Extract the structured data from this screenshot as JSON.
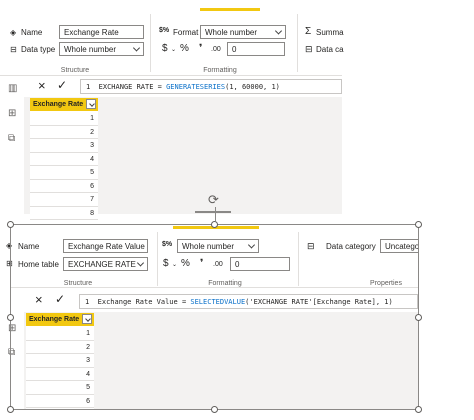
{
  "top": {
    "structure": {
      "name_label": "Name",
      "name_value": "Exchange Rate",
      "datatype_label": "Data type",
      "datatype_value": "Whole number",
      "group_label": "Structure"
    },
    "formatting": {
      "format_label": "Format",
      "format_value": "Whole number",
      "currency_symbol": "$",
      "percent_symbol": "%",
      "comma_symbol": "❜",
      "decimal_symbol": ".00",
      "decimals_value": "0",
      "group_label": "Formatting"
    },
    "properties": {
      "summarize_label": "Summa",
      "datacategory_label": "Data ca"
    },
    "formula": {
      "line": "1",
      "prefix": "EXCHANGE RATE = ",
      "function": "GENERATESERIES",
      "args": "(1, 60000, 1)"
    },
    "table": {
      "header": "Exchange Rate",
      "rows": [
        "1",
        "2",
        "3",
        "4",
        "5",
        "6",
        "7",
        "8"
      ]
    }
  },
  "bottom": {
    "structure": {
      "name_label": "Name",
      "name_value": "Exchange Rate Value",
      "hometable_label": "Home table",
      "hometable_value": "EXCHANGE RATE",
      "group_label": "Structure"
    },
    "formatting": {
      "format_value": "Whole number",
      "currency_symbol": "$",
      "percent_symbol": "%",
      "comma_symbol": "❜",
      "decimal_symbol": ".00",
      "decimals_value": "0",
      "group_label": "Formatting"
    },
    "properties": {
      "datacategory_label": "Data category",
      "datacategory_value": "Uncatego",
      "group_label": "Properties"
    },
    "formula": {
      "line": "1",
      "prefix": "Exchange Rate Value = ",
      "function": "SELECTEDVALUE",
      "args": "('EXCHANGE RATE'[Exchange Rate], 1)"
    },
    "table": {
      "header": "Exchange Rate",
      "rows": [
        "1",
        "2",
        "3",
        "4",
        "5",
        "6"
      ]
    }
  },
  "icons": {
    "cancel": "×",
    "commit": "✓",
    "sigma": "Σ",
    "rotate": "⟳"
  },
  "colors": {
    "accent": "#f2c811",
    "function": "#0a70c9",
    "canvas": "#f3f2f1"
  }
}
